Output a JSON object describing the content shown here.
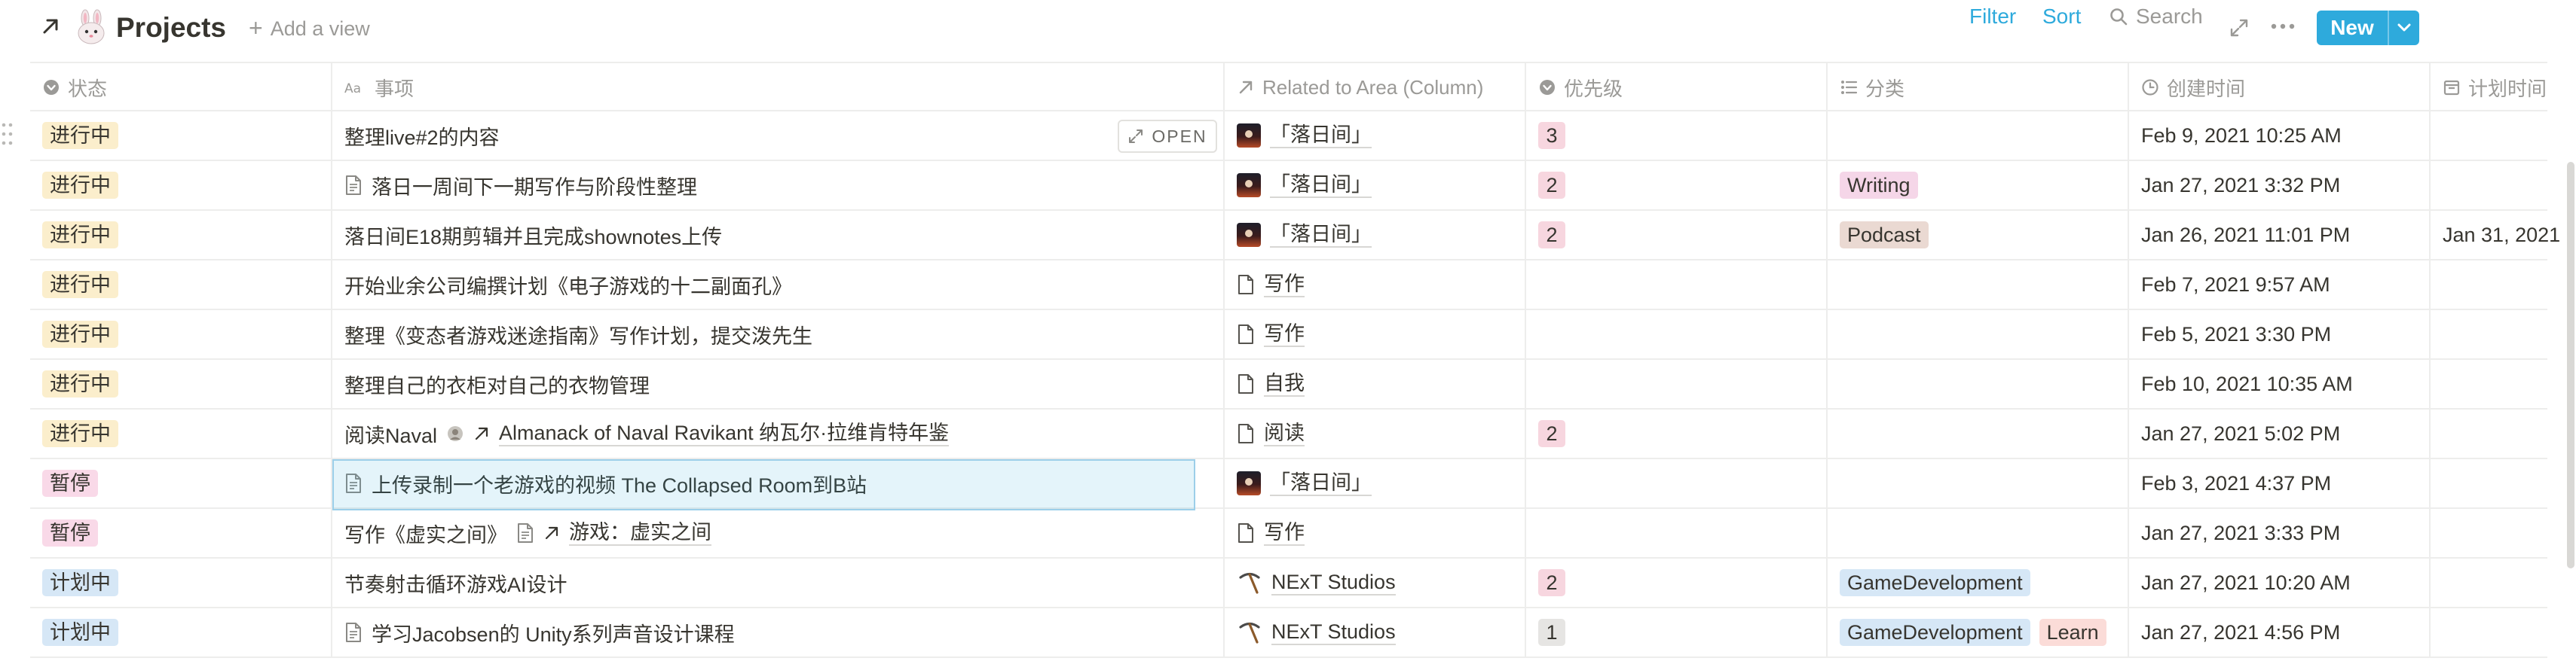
{
  "header": {
    "title": "Projects",
    "add_view": "Add a view"
  },
  "toolbar": {
    "filter": "Filter",
    "sort": "Sort",
    "search": "Search",
    "new_button": "New"
  },
  "columns": [
    {
      "label": "状态",
      "icon": "status-icon"
    },
    {
      "label": "事项",
      "icon": "title-icon"
    },
    {
      "label": "Related to Area (Column)",
      "icon": "relation-arrow-icon"
    },
    {
      "label": "优先级",
      "icon": "select-icon"
    },
    {
      "label": "分类",
      "icon": "multiselect-icon"
    },
    {
      "label": "创建时间",
      "icon": "clock-icon"
    },
    {
      "label": "计划时间",
      "icon": "calendar-icon"
    }
  ],
  "open_button": "OPEN",
  "rows": [
    {
      "status": "进行中",
      "title": "整理live#2的内容",
      "area": "「落日间」",
      "priority": "3",
      "categories": [],
      "created": "Feb 9, 2021 10:25 AM",
      "planned": ""
    },
    {
      "status": "进行中",
      "title": "落日一周间下一期写作与阶段性整理",
      "area": "「落日间」",
      "priority": "2",
      "categories": [
        "Writing"
      ],
      "created": "Jan 27, 2021 3:32 PM",
      "planned": ""
    },
    {
      "status": "进行中",
      "title": "落日间E18期剪辑并且完成shownotes上传",
      "area": "「落日间」",
      "priority": "2",
      "categories": [
        "Podcast"
      ],
      "created": "Jan 26, 2021 11:01 PM",
      "planned": "Jan 31, 2021"
    },
    {
      "status": "进行中",
      "title": "开始业余公司编撰计划《电子游戏的十二副面孔》",
      "area": "写作",
      "priority": "",
      "categories": [],
      "created": "Feb 7, 2021 9:57 AM",
      "planned": ""
    },
    {
      "status": "进行中",
      "title": "整理《变态者游戏迷途指南》写作计划，提交泼先生",
      "area": "写作",
      "priority": "",
      "categories": [],
      "created": "Feb 5, 2021 3:30 PM",
      "planned": ""
    },
    {
      "status": "进行中",
      "title": "整理自己的衣柜对自己的衣物管理",
      "area": "自我",
      "priority": "",
      "categories": [],
      "created": "Feb 10, 2021 10:35 AM",
      "planned": ""
    },
    {
      "status": "进行中",
      "title": "阅读Naval",
      "title_link": "Almanack of Naval Ravikant 纳瓦尔·拉维肯特年鉴",
      "area": "阅读",
      "priority": "2",
      "categories": [],
      "created": "Jan 27, 2021 5:02 PM",
      "planned": ""
    },
    {
      "status": "暂停",
      "title": "上传录制一个老游戏的视频 The Collapsed Room到B站",
      "area": "「落日间」",
      "priority": "",
      "categories": [],
      "created": "Feb 3, 2021 4:37 PM",
      "planned": ""
    },
    {
      "status": "暂停",
      "title": "写作《虚实之间》",
      "title_link": "游戏：虚实之间",
      "area": "写作",
      "priority": "",
      "categories": [],
      "created": "Jan 27, 2021 3:33 PM",
      "planned": ""
    },
    {
      "status": "计划中",
      "title": "节奏射击循环游戏AI设计",
      "area": "NExT Studios",
      "priority": "2",
      "categories": [
        "GameDevelopment"
      ],
      "created": "Jan 27, 2021 10:20 AM",
      "planned": ""
    },
    {
      "status": "计划中",
      "title": "学习Jacobsen的 Unity系列声音设计课程",
      "area": "NExT Studios",
      "priority": "1",
      "categories": [
        "GameDevelopment",
        "Learn"
      ],
      "created": "Jan 27, 2021 4:56 PM",
      "planned": ""
    }
  ]
}
